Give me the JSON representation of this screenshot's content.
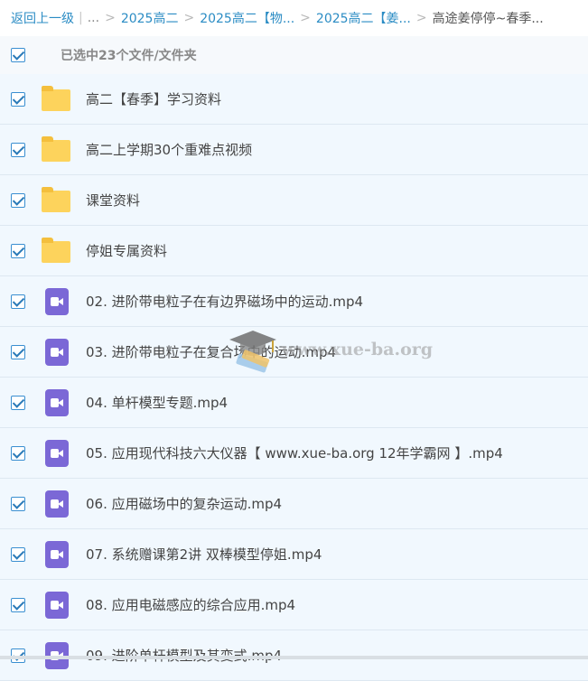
{
  "breadcrumb": {
    "back": "返回上一级",
    "ellipsis": "...",
    "items": [
      "2025高二",
      "2025高二【物...",
      "2025高二【姜..."
    ],
    "current": "高途姜停停~春季..."
  },
  "selection": {
    "summary": "已选中23个文件/文件夹",
    "checked": true
  },
  "files": [
    {
      "type": "folder",
      "name": "高二【春季】学习资料",
      "checked": true
    },
    {
      "type": "folder",
      "name": "高二上学期30个重难点视频",
      "checked": true
    },
    {
      "type": "folder",
      "name": "课堂资料",
      "checked": true
    },
    {
      "type": "folder",
      "name": "停姐专属资料",
      "checked": true
    },
    {
      "type": "video",
      "name": "02. 进阶带电粒子在有边界磁场中的运动.mp4",
      "checked": true
    },
    {
      "type": "video",
      "name": "03. 进阶带电粒子在复合场中的运动.mp4",
      "checked": true
    },
    {
      "type": "video",
      "name": "04. 单杆模型专题.mp4",
      "checked": true
    },
    {
      "type": "video",
      "name": "05. 应用现代科技六大仪器【 www.xue-ba.org 12年学霸网 】.mp4",
      "checked": true
    },
    {
      "type": "video",
      "name": "06. 应用磁场中的复杂运动.mp4",
      "checked": true
    },
    {
      "type": "video",
      "name": "07. 系统赠课第2讲 双棒模型停姐.mp4",
      "checked": true
    },
    {
      "type": "video",
      "name": "08. 应用电磁感应的综合应用.mp4",
      "checked": true
    },
    {
      "type": "video",
      "name": "09. 进阶单杆模型及其变式.mp4",
      "checked": true
    }
  ],
  "watermark": {
    "text": "www.xue-ba.org"
  },
  "colors": {
    "link": "#2b8cc4",
    "row_bg": "#f1f8fe",
    "folder": "#fdd35c",
    "video": "#7b68d6",
    "check": "#2a7ab8"
  }
}
